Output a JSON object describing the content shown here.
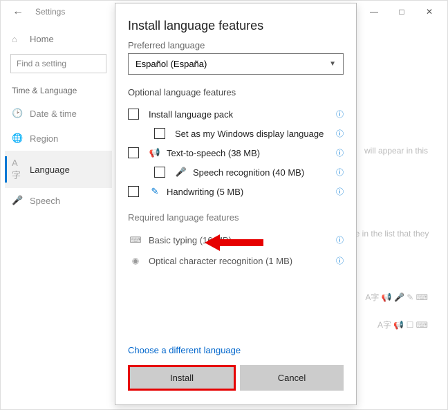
{
  "titlebar": {
    "settings": "Settings"
  },
  "sidebar": {
    "home": "Home",
    "search_placeholder": "Find a setting",
    "section": "Time & Language",
    "items": [
      {
        "label": "Date & time"
      },
      {
        "label": "Region"
      },
      {
        "label": "Language"
      },
      {
        "label": "Speech"
      }
    ]
  },
  "bg_text": {
    "line1": "will appear in this",
    "line2": "ge in the list that they"
  },
  "dialog": {
    "title": "Install language features",
    "preferred_label": "Preferred language",
    "selected_language": "Español (España)",
    "optional_head": "Optional language features",
    "features": {
      "langpack": "Install language pack",
      "display": "Set as my Windows display language",
      "tts": "Text-to-speech (38 MB)",
      "speech": "Speech recognition (40 MB)",
      "handwriting": "Handwriting (5 MB)"
    },
    "required_head": "Required language features",
    "required": {
      "typing": "Basic typing (16 MB)",
      "ocr": "Optical character recognition (1 MB)"
    },
    "link": "Choose a different language",
    "install": "Install",
    "cancel": "Cancel"
  }
}
